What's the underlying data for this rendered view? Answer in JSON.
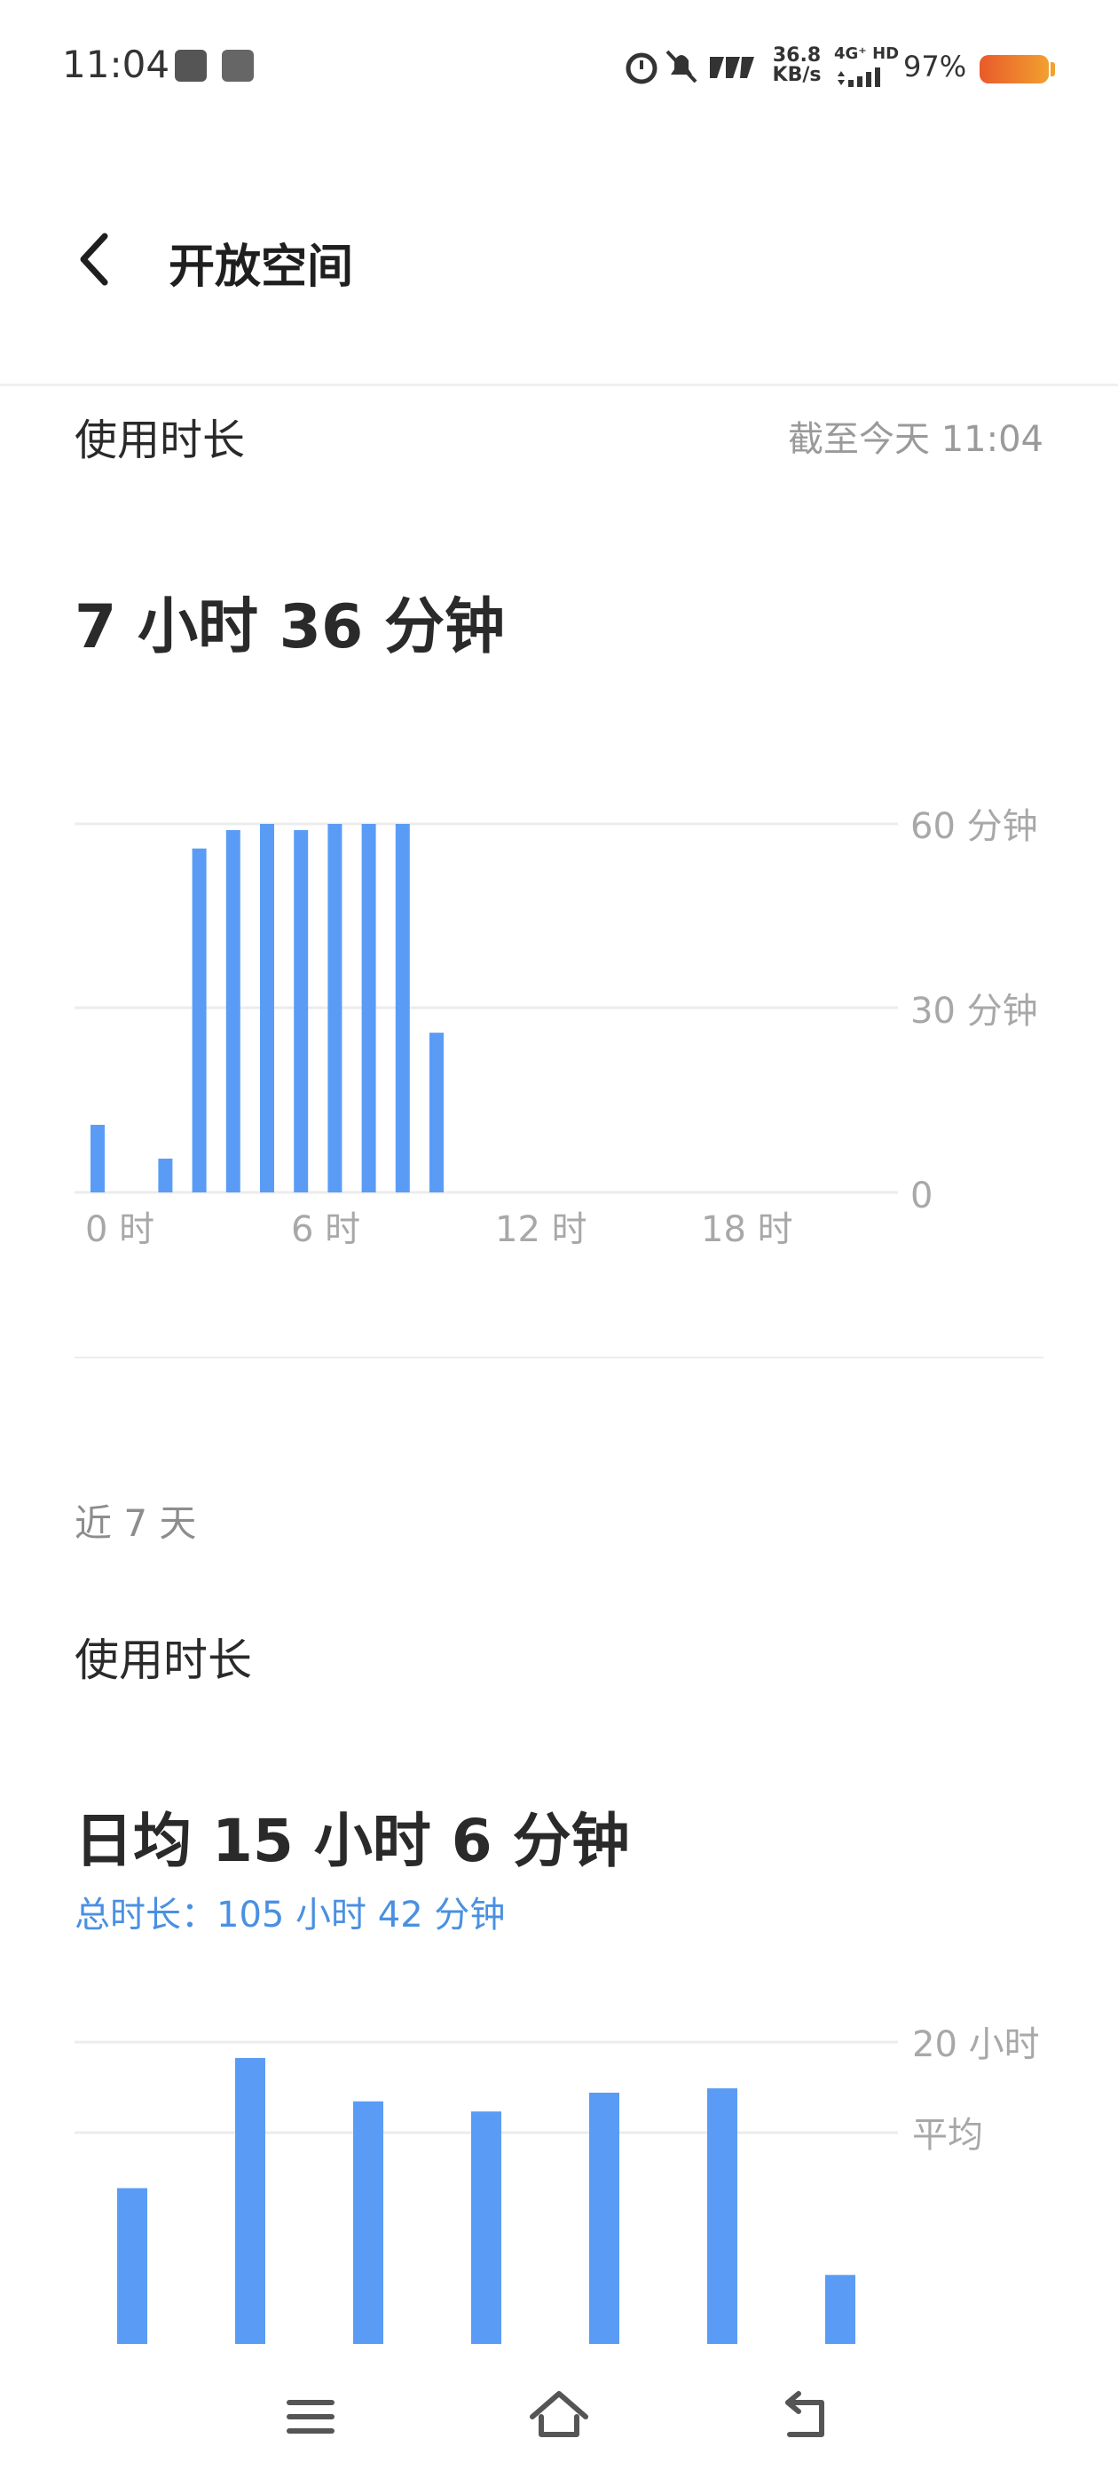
{
  "status_bar": {
    "time": "11:04",
    "net_speed_top": "36.8",
    "net_speed_bottom": "KB/s",
    "network": "4G⁺ HD",
    "battery": "97%"
  },
  "header": {
    "title": "开放空间",
    "back_icon": "chevron-left-icon"
  },
  "today": {
    "label": "使用时长",
    "as_of": "截至今天 11:04",
    "total": "7 小时 36 分钟"
  },
  "recent": {
    "section_label": "近 7 天",
    "label": "使用时长",
    "average": "日均 15 小时 6 分钟",
    "total": "总时长：105 小时 42 分钟"
  },
  "nav": {
    "menu_icon": "menu-icon",
    "home_icon": "home-icon",
    "back_icon": "back-arrow-icon"
  },
  "colors": {
    "bar": "#5a9cf5",
    "accent": "#4a90e2",
    "grid": "#ececec",
    "muted": "#a8a8a8"
  },
  "chart_data": [
    {
      "type": "bar",
      "x": [
        0,
        2,
        3,
        4,
        5,
        6,
        7,
        8,
        9,
        10
      ],
      "values": [
        11,
        5.5,
        56,
        59,
        60,
        59,
        60,
        60,
        60,
        26
      ],
      "xticks": [
        "0 时",
        "6 时",
        "12 时",
        "18 时"
      ],
      "yticks": [
        "60 分钟",
        "30 分钟",
        "0"
      ],
      "ylim": [
        0,
        60
      ],
      "xlim": [
        0,
        24
      ]
    },
    {
      "type": "bar",
      "values": [
        12,
        21,
        18,
        17.3,
        18.6,
        18.9,
        6
      ],
      "yticks": [
        "20 小时",
        "平均"
      ],
      "average": 15.1,
      "ylim": [
        0,
        20
      ]
    }
  ]
}
